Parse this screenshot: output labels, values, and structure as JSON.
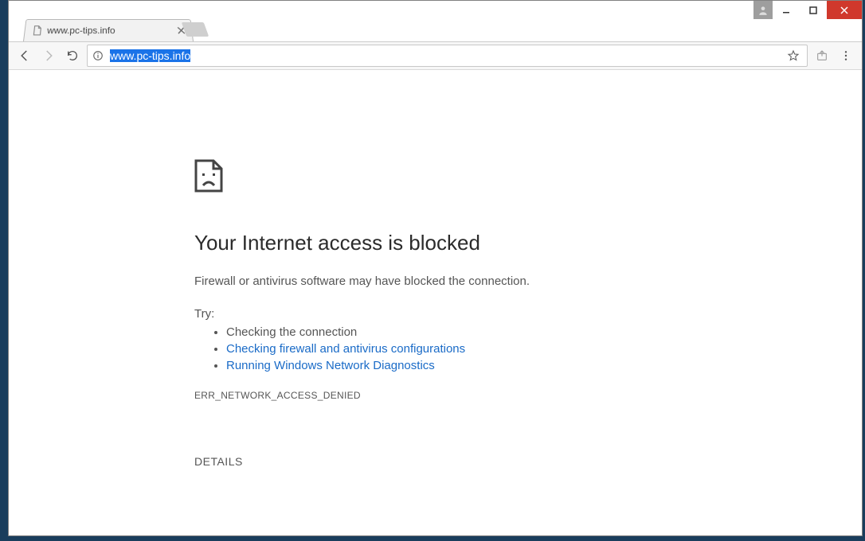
{
  "window": {
    "minimize": "–",
    "maximize": "▢",
    "close": "×"
  },
  "tab": {
    "title": "www.pc-tips.info"
  },
  "omnibox": {
    "url": "www.pc-tips.info"
  },
  "error": {
    "title": "Your Internet access is blocked",
    "subtitle": "Firewall or antivirus software may have blocked the connection.",
    "try_label": "Try:",
    "suggestions": {
      "check_connection": "Checking the connection",
      "firewall_link": "Checking firewall and antivirus configurations",
      "diagnostics_link": "Running Windows Network Diagnostics"
    },
    "code": "ERR_NETWORK_ACCESS_DENIED",
    "details_button": "DETAILS"
  }
}
